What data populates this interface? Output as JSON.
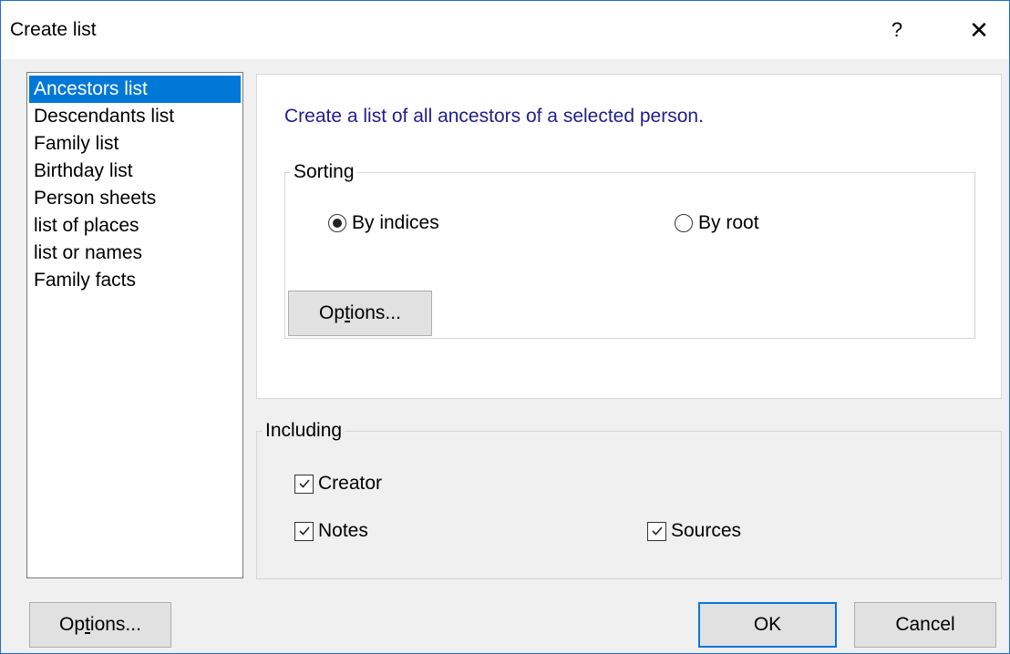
{
  "window": {
    "title": "Create list",
    "help_label": "?",
    "close_label": "✕"
  },
  "list": {
    "items": [
      {
        "label": "Ancestors list",
        "selected": true
      },
      {
        "label": "Descendants list",
        "selected": false
      },
      {
        "label": "Family list",
        "selected": false
      },
      {
        "label": "Birthday list",
        "selected": false
      },
      {
        "label": "Person sheets",
        "selected": false
      },
      {
        "label": "list of places",
        "selected": false
      },
      {
        "label": "list or names",
        "selected": false
      },
      {
        "label": "Family facts",
        "selected": false
      }
    ]
  },
  "panel": {
    "description": "Create a list of all ancestors of a selected person.",
    "sorting": {
      "legend": "Sorting",
      "by_indices": {
        "label": "By indices",
        "checked": true
      },
      "by_root": {
        "label": "By root",
        "checked": false
      }
    },
    "options_button": {
      "pre": "Op",
      "accel": "t",
      "post": "ions..."
    }
  },
  "including": {
    "legend": "Including",
    "creator": {
      "label": "Creator",
      "checked": true
    },
    "notes": {
      "label": "Notes",
      "checked": true
    },
    "sources": {
      "label": "Sources",
      "checked": true
    }
  },
  "footer": {
    "options_button": {
      "pre": "Op",
      "accel": "t",
      "post": "ions..."
    },
    "ok_label": "OK",
    "cancel_label": "Cancel"
  },
  "colors": {
    "selection": "#0078d7",
    "description_text": "#1e1e8a",
    "window_border": "#1c6fc9"
  }
}
